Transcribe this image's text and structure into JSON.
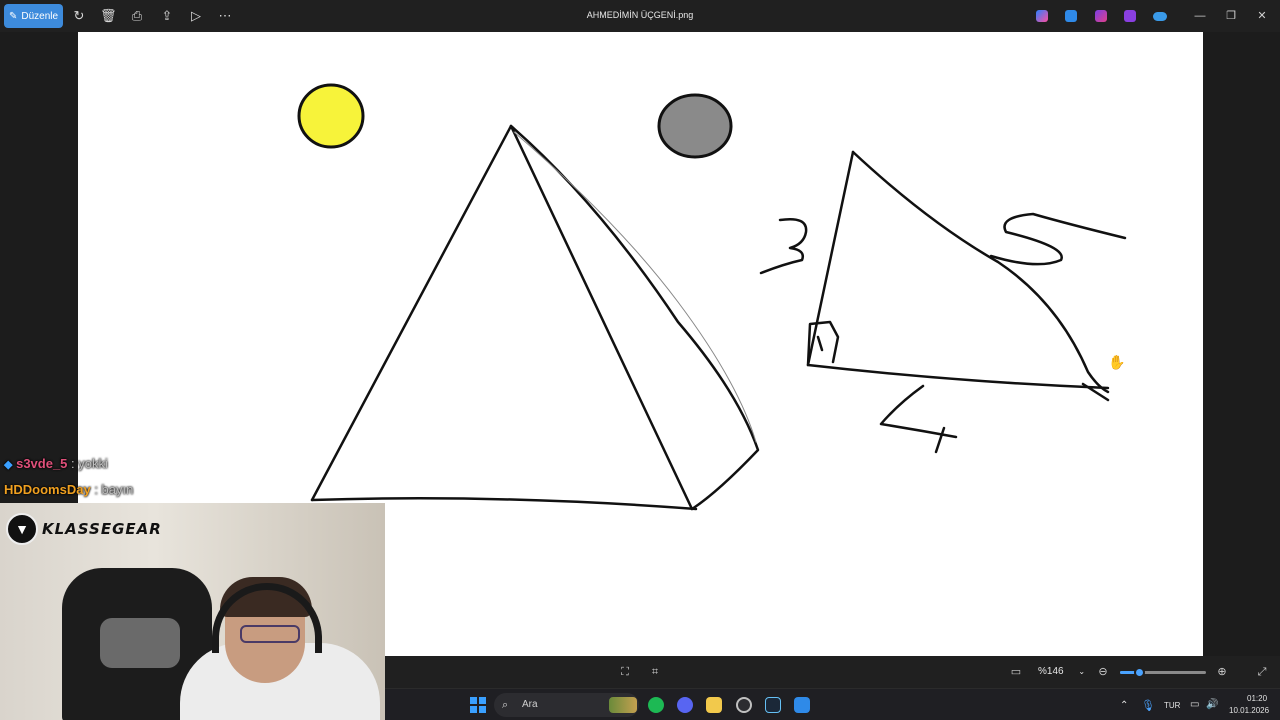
{
  "app": {
    "title": "AHMEDİMİN ÜÇGENİ.png",
    "edit_label": "Düzenle"
  },
  "toolbar": {
    "icons": [
      "rotate-icon",
      "delete-icon",
      "print-icon",
      "share-icon",
      "slideshow-icon",
      "more-icon"
    ]
  },
  "tray_apps": [
    "copilot",
    "photos-editor",
    "clipchamp",
    "designer",
    "onedrive"
  ],
  "colors": {
    "accent": "#3d8bdc",
    "sun_yellow": "#f7f33a",
    "moon_gray": "#8a8a8a",
    "chat_user1": "#e0507a",
    "chat_user2": "#f0a020"
  },
  "drawing": {
    "label_three": "3",
    "label_four": "4",
    "label_five": "5"
  },
  "chat": [
    {
      "user": "s3vde_5",
      "message": ": yokki"
    },
    {
      "user": "HDDoomsDay",
      "message": ": bayın"
    }
  ],
  "webcam": {
    "brand": "KLASSEGEAR"
  },
  "viewer_bottom": {
    "zoom_label": "%146",
    "zoom_fraction": 0.22
  },
  "taskbar": {
    "search_placeholder": "Ara",
    "language": "TUR",
    "time": "01:20",
    "date": "10.01.2026"
  }
}
